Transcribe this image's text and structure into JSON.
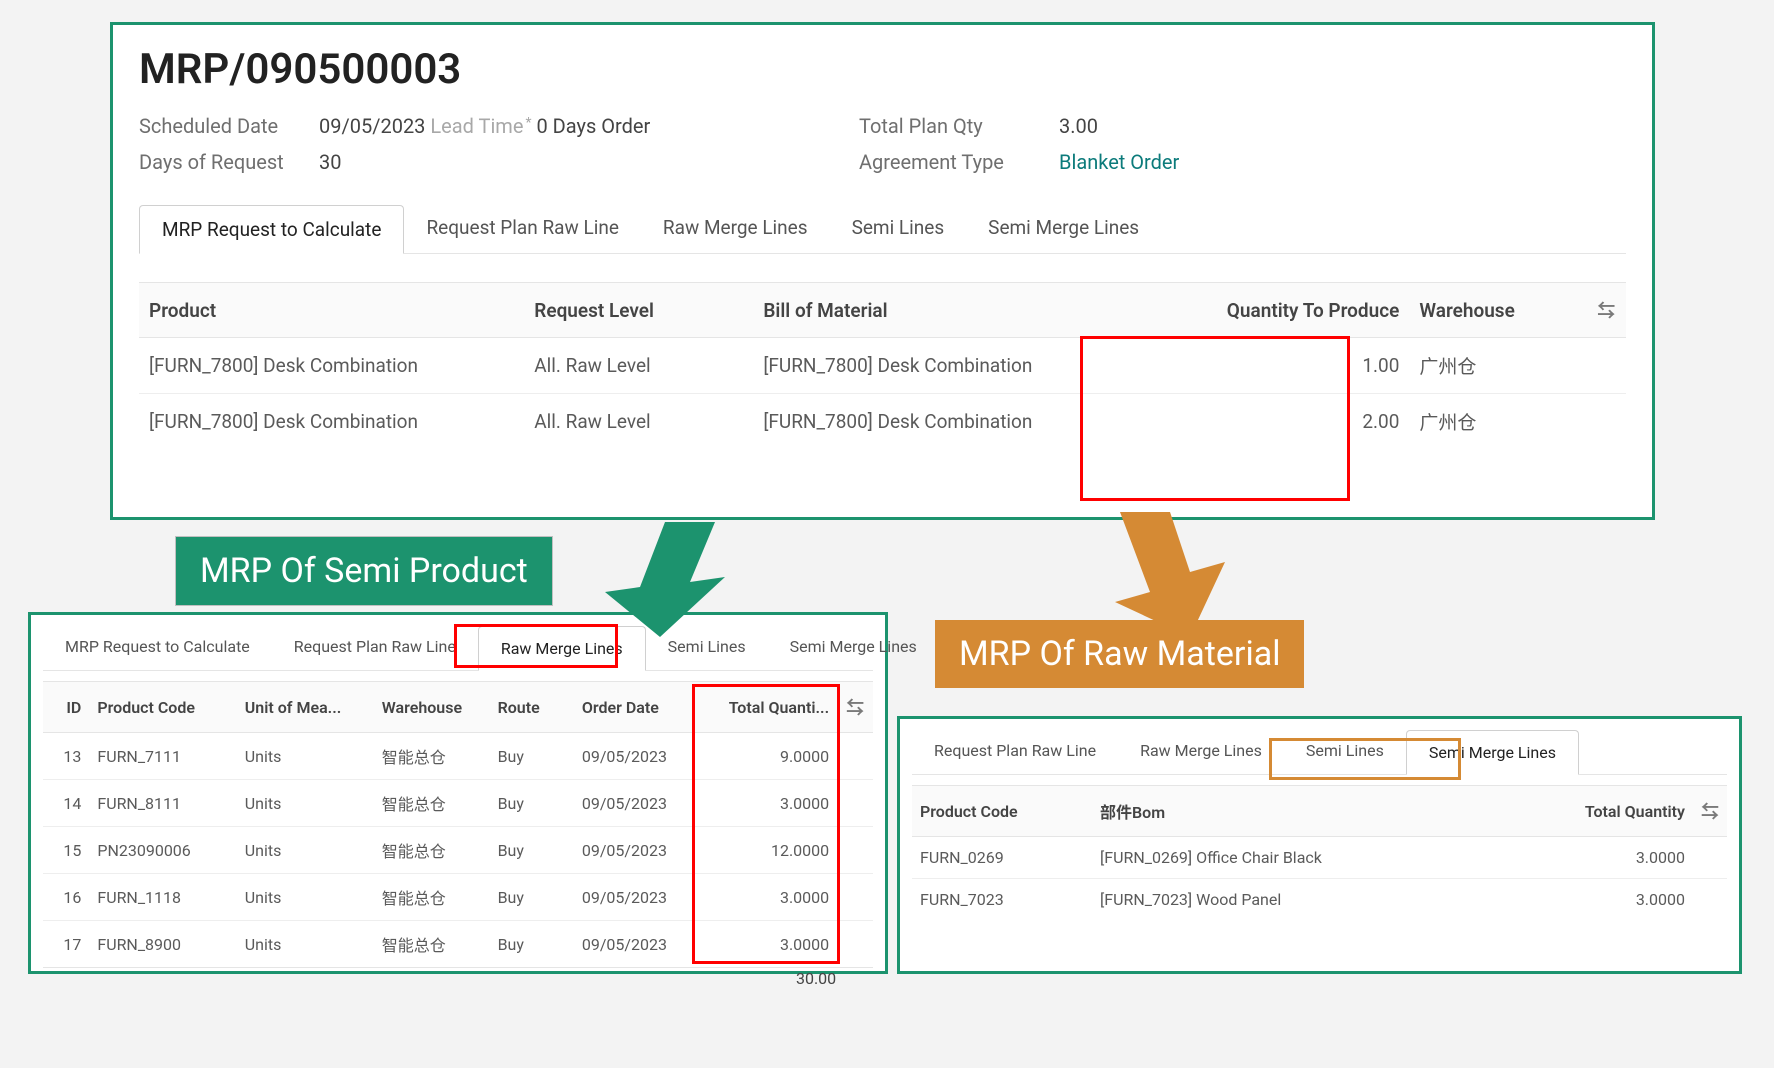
{
  "top": {
    "title": "MRP/090500003",
    "fields": {
      "scheduled_date_label": "Scheduled Date",
      "scheduled_date": "09/05/2023",
      "lead_time_note": "Lead Time",
      "lead_time_suffix": "0 Days Order",
      "days_request_label": "Days of Request",
      "days_request": "30",
      "total_plan_label": "Total Plan Qty",
      "total_plan": "3.00",
      "agreement_label": "Agreement Type",
      "agreement": "Blanket Order"
    },
    "tabs": [
      "MRP Request to Calculate",
      "Request Plan Raw Line",
      "Raw Merge Lines",
      "Semi Lines",
      "Semi Merge Lines"
    ],
    "active_tab": 0,
    "columns": {
      "product": "Product",
      "request_level": "Request Level",
      "bom": "Bill of Material",
      "qty": "Quantity To Produce",
      "wh": "Warehouse"
    },
    "rows": [
      {
        "product": "[FURN_7800] Desk Combination",
        "level": "All. Raw Level",
        "bom": "[FURN_7800] Desk Combination",
        "qty": "1.00",
        "wh": "广州仓"
      },
      {
        "product": "[FURN_7800] Desk Combination",
        "level": "All. Raw Level",
        "bom": "[FURN_7800] Desk Combination",
        "qty": "2.00",
        "wh": "广州仓"
      }
    ]
  },
  "callouts": {
    "semi": "MRP Of Semi Product",
    "raw": "MRP Of Raw Material"
  },
  "bl": {
    "tabs": [
      "MRP Request to Calculate",
      "Request Plan Raw Line",
      "Raw Merge Lines",
      "Semi Lines",
      "Semi Merge Lines"
    ],
    "active_tab": 2,
    "columns": {
      "id": "ID",
      "code": "Product Code",
      "uom": "Unit of Mea...",
      "wh": "Warehouse",
      "route": "Route",
      "date": "Order Date",
      "qty": "Total Quanti..."
    },
    "rows": [
      {
        "id": "13",
        "code": "FURN_7111",
        "uom": "Units",
        "wh": "智能总仓",
        "route": "Buy",
        "date": "09/05/2023",
        "qty": "9.0000"
      },
      {
        "id": "14",
        "code": "FURN_8111",
        "uom": "Units",
        "wh": "智能总仓",
        "route": "Buy",
        "date": "09/05/2023",
        "qty": "3.0000"
      },
      {
        "id": "15",
        "code": "PN23090006",
        "uom": "Units",
        "wh": "智能总仓",
        "route": "Buy",
        "date": "09/05/2023",
        "qty": "12.0000"
      },
      {
        "id": "16",
        "code": "FURN_1118",
        "uom": "Units",
        "wh": "智能总仓",
        "route": "Buy",
        "date": "09/05/2023",
        "qty": "3.0000"
      },
      {
        "id": "17",
        "code": "FURN_8900",
        "uom": "Units",
        "wh": "智能总仓",
        "route": "Buy",
        "date": "09/05/2023",
        "qty": "3.0000"
      }
    ],
    "total": "30.00"
  },
  "br": {
    "tabs": [
      "Request Plan Raw Line",
      "Raw Merge Lines",
      "Semi Lines",
      "Semi Merge Lines"
    ],
    "active_tab": 3,
    "columns": {
      "code": "Product Code",
      "bom": "部件Bom",
      "qty": "Total Quantity"
    },
    "rows": [
      {
        "code": "FURN_0269",
        "bom": "[FURN_0269] Office Chair Black",
        "qty": "3.0000"
      },
      {
        "code": "FURN_7023",
        "bom": "[FURN_7023] Wood Panel",
        "qty": "3.0000"
      }
    ]
  },
  "icons": {
    "settings": "⇆"
  }
}
